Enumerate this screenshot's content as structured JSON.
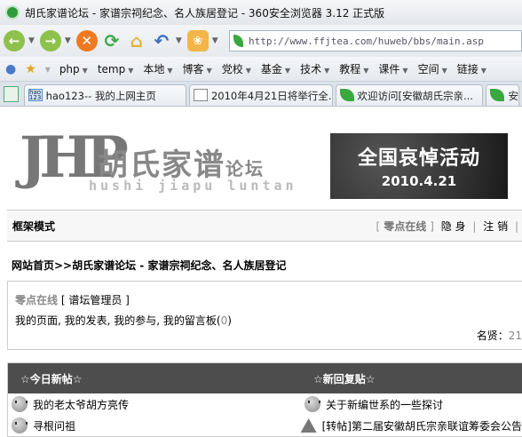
{
  "browser": {
    "title": "胡氏家谱论坛 - 家谱宗祠纪念、名人族居登记 - 360安全浏览器 3.12 正式版",
    "url": "http://www.ffjtea.com/huweb/bbs/main.asp",
    "bookmarks": [
      "php",
      "temp",
      "本地",
      "博客",
      "党校",
      "基金",
      "技术",
      "教程",
      "课件",
      "空间",
      "链接"
    ],
    "tabs": [
      {
        "label": "hao123-- 我的上网主页",
        "favicon": "hao123-icon"
      },
      {
        "label": "2010年4月21日将举行全...",
        "favicon": "document-icon"
      },
      {
        "label": "欢迎访问[安徽胡氏宗亲...",
        "favicon": "leaf-icon"
      },
      {
        "label": "安徽",
        "favicon": "leaf-icon"
      }
    ]
  },
  "banner": {
    "logo_letters": "JHP",
    "site_name": "胡氏家谱",
    "site_suffix": "论坛",
    "site_pinyin": "hushi jiapu luntan",
    "event_title": "全国哀悼活动",
    "event_date": "2010.4.21"
  },
  "modebar": {
    "mode": "框架模式",
    "user": "零点在线",
    "hide": "隐 身",
    "logout": "注 销"
  },
  "breadcrumb": "网站首页>>胡氏家谱论坛 - 家谱宗祠纪念、名人族居登记",
  "userbox": {
    "username": "零点在线",
    "role": "谱坛管理员",
    "links": "我的页面, 我的发表, 我的参与, 我的留言板",
    "msg_count": "0",
    "reputation_label": "名贤：",
    "reputation_value": "21"
  },
  "lists": {
    "today_title": "☆今日新帖☆",
    "reply_title": "☆新回复贴☆",
    "today": [
      "我的老太爷胡方亮传",
      "寻根问祖"
    ],
    "reply": [
      "关于新编世系的一些探讨",
      "[转帖]第二届安徽胡氏宗亲联谊筹委会公告"
    ]
  }
}
